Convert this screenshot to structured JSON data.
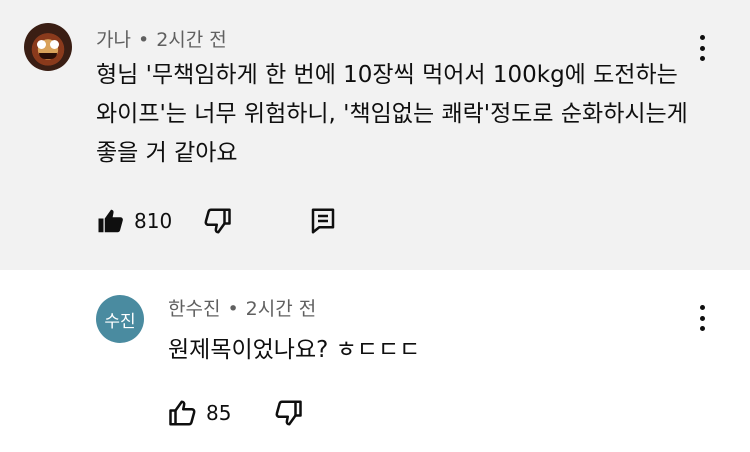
{
  "comments": [
    {
      "author": "가나",
      "time": "2시간 전",
      "dot": "•",
      "text": "형님 '무책임하게 한 번에 10장씩 먹어서 100kg에 도전하는 와이프'는 너무 위험하니, '책임없는 쾌락'정도로 순화하시는게 좋을 거 같아요",
      "likes": "810",
      "avatar_icon": "mascot-avatar"
    },
    {
      "author": "한수진",
      "time": "2시간 전",
      "dot": "•",
      "text": "원제목이었나요? ㅎㄷㄷㄷ",
      "likes": "85",
      "avatar_text": "수진"
    }
  ],
  "colors": {
    "highlight_bg": "#f2f2f2",
    "avatar_blue": "#4a8ba0",
    "meta_gray": "#606060"
  },
  "icons": [
    "thumbs-up-filled-icon",
    "thumbs-down-icon",
    "reply-icon",
    "more-vert-icon",
    "thumbs-up-outline-icon"
  ]
}
